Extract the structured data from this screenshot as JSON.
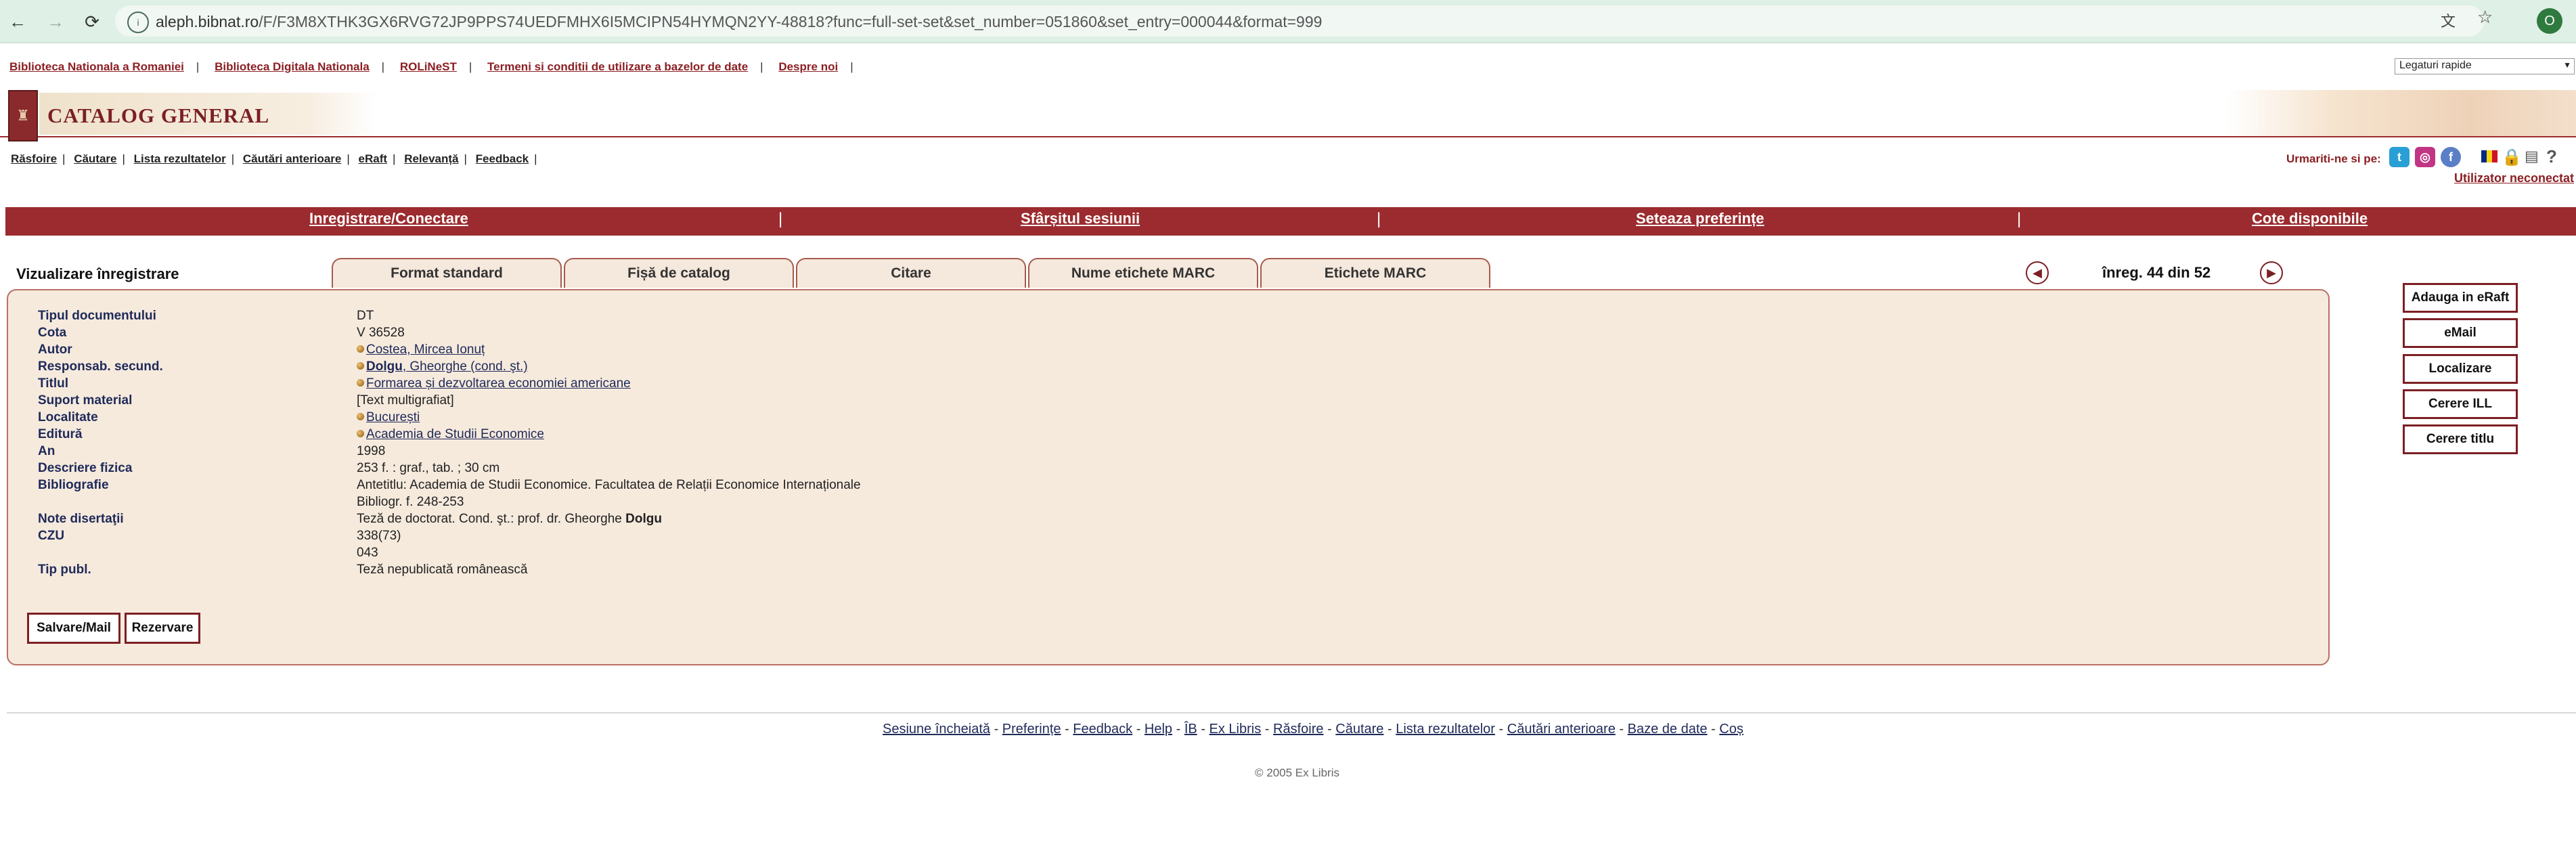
{
  "browser": {
    "url_host": "aleph.bibnat.ro",
    "url_rest": "/F/F3M8XTHK3GX6RVG72JP9PPS74UEDFMHX6I5MCIPN54HYMQN2YY-48818?func=full-set-set&set_number=051860&set_entry=000044&format=999",
    "profile_initial": "O"
  },
  "top_links": [
    "Biblioteca Nationala a Romaniei",
    "Biblioteca Digitala Nationala",
    "ROLiNeST",
    "Termeni si conditii de utilizare a bazelor de date",
    "Despre noi"
  ],
  "quick_links": "Legaturi rapide",
  "header": {
    "title": "CATALOG GENERAL"
  },
  "nav_links": [
    "Răsfoire",
    "Căutare",
    "Lista rezultatelor",
    "Căutări anterioare",
    "eRaft",
    "Relevanță",
    "Feedback"
  ],
  "follow_label": "Urmariti-ne si pe:",
  "user_status": "Utilizator neconectat",
  "red_bar": [
    "Inregistrare/Conectare",
    "Sfârșitul sesiunii",
    "Seteaza preferințe",
    "Cote disponibile"
  ],
  "view_title": "Vizualizare înregistrare",
  "tabs": [
    "Format standard",
    "Fișă de catalog",
    "Citare",
    "Nume etichete MARC",
    "Etichete MARC"
  ],
  "record_nav": {
    "count": "înreg. 44 din 52"
  },
  "record": {
    "fields": [
      {
        "label": "Tipul documentului",
        "value": "DT"
      },
      {
        "label": "Cota",
        "value": "V 36528"
      },
      {
        "label": "Autor",
        "value": "Costea, Mircea Ionuț"
      },
      {
        "label": "Responsab. secund.",
        "value_bold": "Dolgu",
        "value": ", Gheorghe (cond. şt.)"
      },
      {
        "label": "Titlul",
        "value": "Formarea și dezvoltarea economiei americane"
      },
      {
        "label": "Suport material",
        "value": "[Text multigrafiat]"
      },
      {
        "label": "Localitate",
        "value": "București"
      },
      {
        "label": "Editură",
        "value": "Academia de Studii Economice"
      },
      {
        "label": "An",
        "value": "1998"
      },
      {
        "label": "Descriere fizica",
        "value": "253 f. : graf., tab. ; 30 cm"
      },
      {
        "label": "Bibliografie",
        "value": "Antetitlu: Academia de Studii Economice. Facultatea de Relații Economice Internaționale"
      },
      {
        "label": "",
        "value": "Bibliogr. f. 248-253"
      },
      {
        "label": "Note disertaţii",
        "value": "Teză de doctorat. Cond. şt.: prof. dr. Gheorghe ",
        "value_bold": "Dolgu"
      },
      {
        "label": "CZU",
        "value": "338(73)"
      },
      {
        "label": "",
        "value": "043"
      },
      {
        "label": "Tip publ.",
        "value": "Teză nepublicată românească"
      }
    ]
  },
  "panel_buttons": [
    "Salvare/Mail",
    "Rezervare"
  ],
  "side_buttons": [
    "Adauga in eRaft",
    "eMail",
    "Localizare",
    "Cerere ILL",
    "Cerere titlu"
  ],
  "footer": {
    "links": [
      "Sesiune încheiată",
      "Preferințe",
      "Feedback",
      "Help",
      "ÎB",
      "Ex Libris",
      "Răsfoire",
      "Căutare",
      "Lista rezultatelor",
      "Căutări anterioare",
      "Baze de date",
      "Coș"
    ],
    "copyright": "© 2005 Ex Libris"
  }
}
